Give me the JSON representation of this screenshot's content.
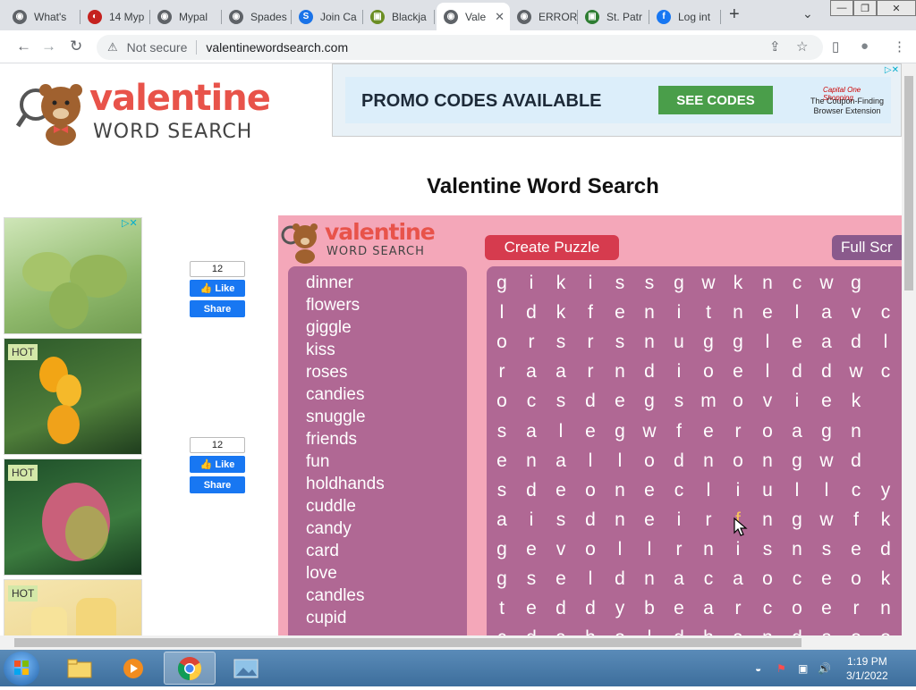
{
  "browser": {
    "tabs": [
      {
        "label": "What's",
        "color": "#5f6368",
        "glyph": "◉"
      },
      {
        "label": "14 Myp",
        "color": "#c5221f",
        "glyph": "◐"
      },
      {
        "label": "Mypal",
        "color": "#5f6368",
        "glyph": "◉"
      },
      {
        "label": "Spades",
        "color": "#5f6368",
        "glyph": "◉"
      },
      {
        "label": "Join Ca",
        "color": "#1a73e8",
        "glyph": "S"
      },
      {
        "label": "Blackja",
        "color": "#6b8e23",
        "glyph": "▣"
      },
      {
        "label": "Vale",
        "color": "#5f6368",
        "glyph": "◉",
        "active": true
      },
      {
        "label": "ERROR",
        "color": "#5f6368",
        "glyph": "◉"
      },
      {
        "label": "St. Patr",
        "color": "#2e7d32",
        "glyph": "▣"
      },
      {
        "label": "Log int",
        "color": "#1877f2",
        "glyph": "f"
      }
    ],
    "close_glyph": "✕",
    "new_tab": "+",
    "tab_dropdown": "⌄",
    "window_controls": {
      "minimize": "—",
      "maximize": "❐",
      "close": "✕"
    },
    "nav": {
      "back": "←",
      "forward": "→",
      "reload": "↻"
    },
    "address": {
      "security_icon": "⚠",
      "security_label": "Not secure",
      "url": "valentinewordsearch.com"
    },
    "toolbar_icons": {
      "share": "⇪",
      "bookmark": "☆",
      "sidepanel": "▯",
      "profile": "●",
      "menu": "⋮"
    }
  },
  "site": {
    "logo": {
      "line1": "valentine",
      "line2": "WORD SEARCH"
    },
    "banner": {
      "headline": "PROMO CODES AVAILABLE",
      "cta": "SEE CODES",
      "brand": "Capital One Shopping",
      "tagline": "The Coupon-Finding Browser Extension",
      "adchoices": "▷✕"
    },
    "title": "Valentine Word Search",
    "side_ad": {
      "adchoices": "▷✕",
      "hot_label": "HOT"
    },
    "facebook": [
      {
        "count": "12",
        "like": "Like",
        "share": "Share"
      },
      {
        "count": "12",
        "like": "Like",
        "share": "Share"
      }
    ],
    "puzzle": {
      "logo": {
        "line1": "valentine",
        "line2": "WORD SEARCH"
      },
      "create_button": "Create Puzzle",
      "fullscreen_button": "Full Scr",
      "words": [
        "dinner",
        "flowers",
        "giggle",
        "kiss",
        "roses",
        "candies",
        "snuggle",
        "friends",
        "fun",
        "holdhands",
        "cuddle",
        "candy",
        "card",
        "love",
        "candles",
        "cupid"
      ],
      "grid": [
        "gikissgwkncwg",
        "ldkfenitnelavc",
        "orsrsnuggleadl",
        "raarndioelddwc",
        "ocsdegsmoviek",
        "salegwferoagn",
        "enallodnongwd",
        "sdeonecliullcy",
        "aisdneirfngwfk",
        "gevollrnisnsed",
        "gseldnacaoceok",
        "teddybearcoern",
        "cdaholdhandsoo"
      ],
      "highlight": {
        "row": 8,
        "col": 8
      }
    }
  },
  "taskbar": {
    "clock_time": "1:19 PM",
    "clock_date": "3/1/2022"
  }
}
